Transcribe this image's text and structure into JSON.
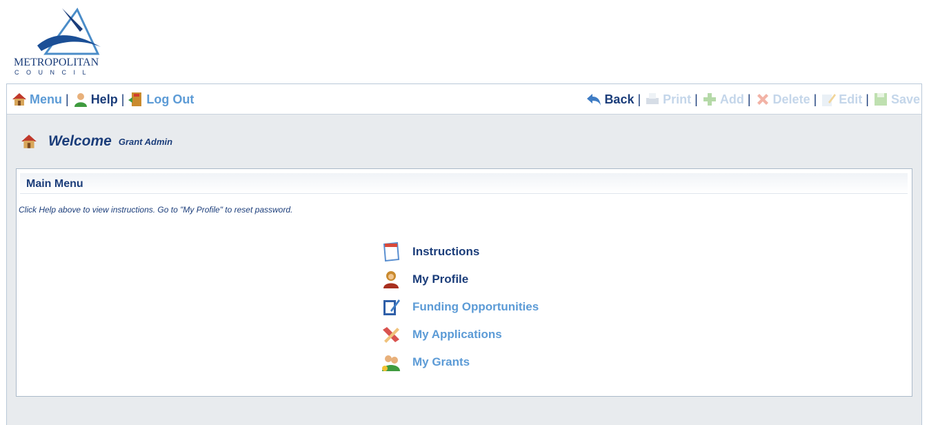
{
  "logo": {
    "name": "METROPOLITAN",
    "sub": "COUNCIL"
  },
  "toolbar": {
    "left": [
      {
        "label": "Menu",
        "icon": "home-icon",
        "state": "link"
      },
      {
        "label": "Help",
        "icon": "person-help-icon",
        "state": "active"
      },
      {
        "label": "Log Out",
        "icon": "exit-door-icon",
        "state": "link"
      }
    ],
    "right": [
      {
        "label": "Back",
        "icon": "back-arrow-icon",
        "state": "active"
      },
      {
        "label": "Print",
        "icon": "printer-icon",
        "state": "disabled"
      },
      {
        "label": "Add",
        "icon": "plus-icon",
        "state": "disabled"
      },
      {
        "label": "Delete",
        "icon": "x-icon",
        "state": "disabled"
      },
      {
        "label": "Edit",
        "icon": "pencil-icon",
        "state": "disabled"
      },
      {
        "label": "Save",
        "icon": "floppy-icon",
        "state": "disabled"
      }
    ],
    "separator": "|"
  },
  "welcome": {
    "title": "Welcome",
    "user": "Grant Admin"
  },
  "main_menu": {
    "title": "Main Menu",
    "note": "Click Help above to view instructions. Go to \"My Profile\" to reset password.",
    "items": [
      {
        "label": "Instructions",
        "icon": "calendar-page-icon",
        "state": "active"
      },
      {
        "label": "My Profile",
        "icon": "user-profile-icon",
        "state": "active"
      },
      {
        "label": "Funding Opportunities",
        "icon": "checklist-icon",
        "state": "link"
      },
      {
        "label": "My Applications",
        "icon": "pencil-ruler-icon",
        "state": "link"
      },
      {
        "label": "My Grants",
        "icon": "people-grants-icon",
        "state": "link"
      }
    ]
  },
  "colors": {
    "dark_blue": "#1b3d7a",
    "link_blue": "#5c9bd6",
    "disabled": "#c4d6ea",
    "panel_bg": "#e8ebee"
  }
}
